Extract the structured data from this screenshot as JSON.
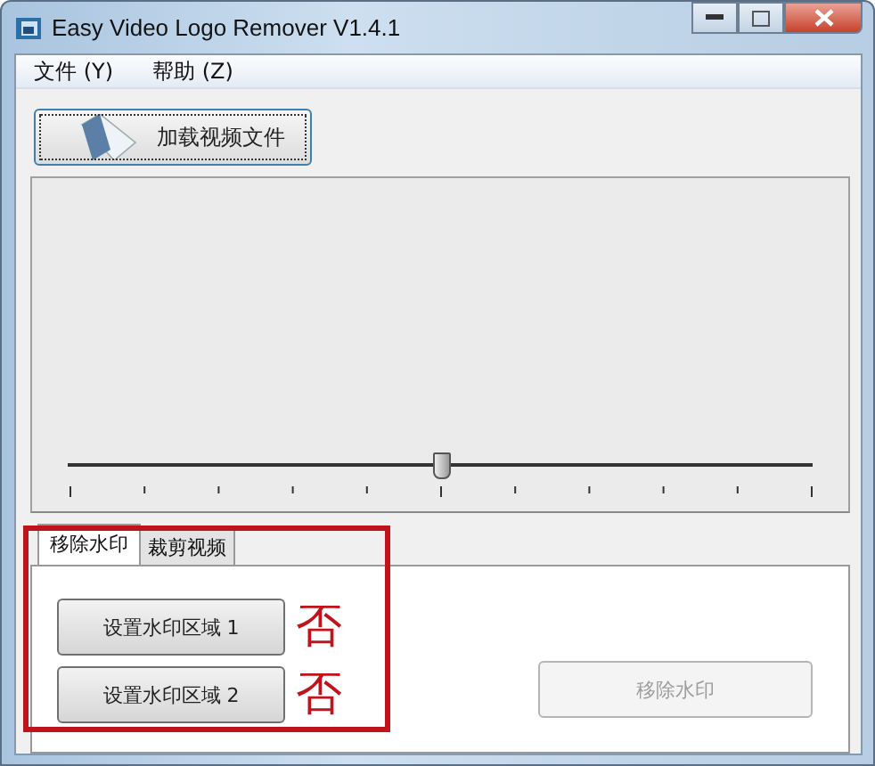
{
  "window": {
    "title": "Easy Video Logo Remover V1.4.1"
  },
  "menu": [
    "文件 (Y)",
    "帮助 (Z)"
  ],
  "load_button": {
    "label": "加载视频文件"
  },
  "timeline": {
    "level": 0.5
  },
  "tabs": [
    {
      "label": "移除水印",
      "selected": true
    },
    {
      "label": "裁剪视频",
      "selected": false
    }
  ],
  "region_buttons": [
    {
      "label": "设置水印区域 1",
      "note": "否"
    },
    {
      "label": "设置水印区域 2",
      "note": "否"
    }
  ],
  "remove_button": {
    "label": "移除水印",
    "disabled": true
  }
}
